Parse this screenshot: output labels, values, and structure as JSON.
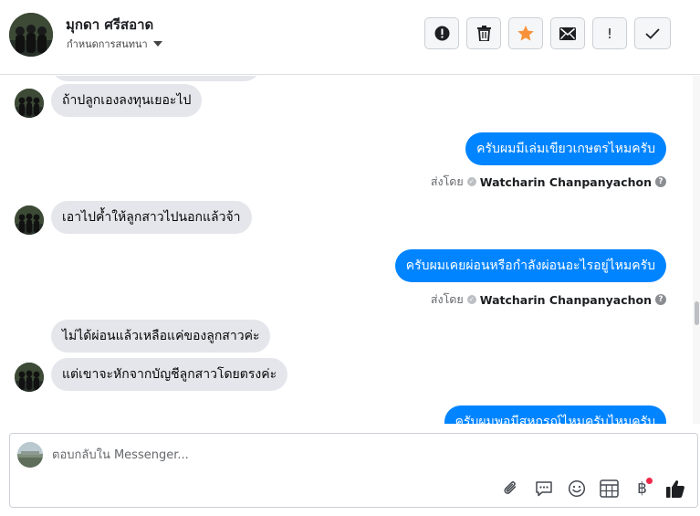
{
  "header": {
    "contact_name": "มุกดา ศรีสอาด",
    "assign_label": "กำหนดการสนทนา",
    "actions": [
      {
        "icon": "alert-circle-icon",
        "label": "!"
      },
      {
        "icon": "trash-icon",
        "label": ""
      },
      {
        "icon": "star-icon",
        "label": ""
      },
      {
        "icon": "envelope-icon",
        "label": ""
      },
      {
        "icon": "exclamation-icon",
        "label": "!"
      },
      {
        "icon": "checkmark-icon",
        "label": "✓"
      }
    ],
    "star_color": "#f7923b"
  },
  "conversation": {
    "messages": [
      {
        "direction": "incoming",
        "text": "ถ้าปลูกเองลงทุนเยอะไป",
        "show_avatar": true
      },
      {
        "direction": "outgoing",
        "text": "ครับผมมีเล่มเขียวเกษตรไหมครับ",
        "sent_by_label": "ส่งโดย",
        "sender": "Watcharin Chanpanyachon"
      },
      {
        "direction": "incoming",
        "text": "เอาไปค้ำให้ลูกสาวไปนอกแล้วจ้า",
        "show_avatar": true
      },
      {
        "direction": "outgoing",
        "text": "ครับผมเคยผ่อนหรือกำลังผ่อนอะไรอยู่ไหมครับ",
        "sent_by_label": "ส่งโดย",
        "sender": "Watcharin Chanpanyachon"
      },
      {
        "direction": "incoming",
        "text": "ไม่ได้ผ่อนแล้วเหลือแค่ของลูกสาวค่ะ",
        "show_avatar": false
      },
      {
        "direction": "incoming",
        "text": "แต่เขาจะหักจากบัญชีลูกสาวโดยตรงค่ะ",
        "show_avatar": true
      },
      {
        "direction": "outgoing",
        "text": "ครับผมพอมีสหกรณ์ไหมครับไหมครับ",
        "partial": true
      }
    ],
    "outgoing_color": "#0084ff",
    "incoming_color": "#e4e6eb"
  },
  "composer": {
    "placeholder": "ตอบกลับใน Messenger...",
    "tools": [
      "paperclip-icon",
      "chat-bubble-icon",
      "emoji-icon",
      "calendar-table-icon",
      "baht-payment-icon",
      "thumbs-up-icon"
    ],
    "payment_symbol": "฿"
  }
}
